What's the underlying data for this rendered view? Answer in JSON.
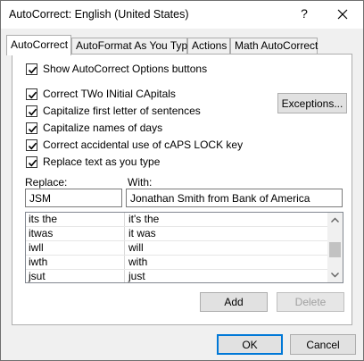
{
  "window": {
    "title": "AutoCorrect: English (United States)",
    "help_glyph": "?"
  },
  "tabs": [
    {
      "label": "AutoCorrect",
      "active": true
    },
    {
      "label": "AutoFormat As You Type",
      "active": false
    },
    {
      "label": "Actions",
      "active": false
    },
    {
      "label": "Math AutoCorrect",
      "active": false
    }
  ],
  "options": {
    "show_buttons": {
      "label": "Show AutoCorrect Options buttons",
      "checked": true
    },
    "two_initial_caps": {
      "label": "Correct TWo INitial CApitals",
      "checked": true
    },
    "capitalize_sentences": {
      "label": "Capitalize first letter of sentences",
      "checked": true
    },
    "capitalize_days": {
      "label": "Capitalize names of days",
      "checked": true
    },
    "caps_lock": {
      "label": "Correct accidental use of cAPS LOCK key",
      "checked": true
    },
    "replace_text": {
      "label": "Replace text as you type",
      "checked": true
    }
  },
  "exceptions_button": "Exceptions...",
  "replace": {
    "replace_label": "Replace:",
    "with_label": "With:",
    "replace_value": "JSM",
    "with_value": "Jonathan Smith from Bank of America"
  },
  "entries": [
    {
      "from": "its the",
      "to": "it's the"
    },
    {
      "from": "itwas",
      "to": "it was"
    },
    {
      "from": "iwll",
      "to": "will"
    },
    {
      "from": "iwth",
      "to": "with"
    },
    {
      "from": "jsut",
      "to": "just"
    }
  ],
  "list_buttons": {
    "add": "Add",
    "delete": "Delete"
  },
  "footer": {
    "ok": "OK",
    "cancel": "Cancel"
  }
}
